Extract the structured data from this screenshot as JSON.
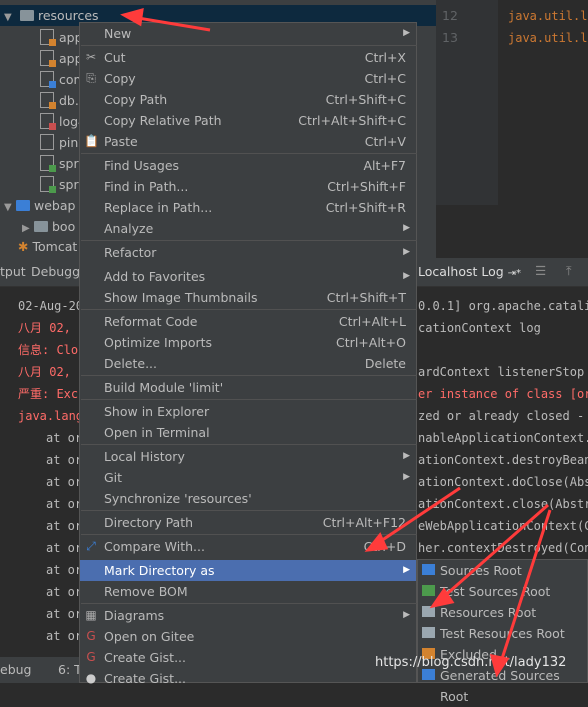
{
  "tree": {
    "resources": "resources",
    "files": [
      "app",
      "app",
      "com",
      "db.p",
      "log4",
      "piny",
      "spri",
      "spri"
    ],
    "webapp": "webap",
    "boot": "boo",
    "tomcat": "Tomcat"
  },
  "editor": {
    "lines": [
      "12",
      "13"
    ],
    "code": [
      "java.util.lo",
      "java.util.lo"
    ]
  },
  "toolbar": {
    "output": "tput",
    "debugger": "Debugger",
    "localhost_log": "Localhost Log"
  },
  "console": [
    {
      "t": "02-Aug-20",
      "r": "0.0.1] org.apache.catalin"
    },
    {
      "t": "八月 02,",
      "r": "cationContext log"
    },
    {
      "t": "信息: Clo",
      "r": ""
    },
    {
      "t": "八月 02,",
      "r": "ardContext listenerStop"
    },
    {
      "t": "严重: Exc",
      "r": "er instance of class [org"
    },
    {
      "t": "java.lang",
      "r": "zed or already closed - c"
    },
    {
      "t": "at or",
      "r": "nableApplicationContext.g"
    },
    {
      "t": "at or",
      "r": "ationContext.destroyBeans"
    },
    {
      "t": "at or",
      "r": "ationContext.doClose(Abstr"
    },
    {
      "t": "at or",
      "r": "ationContext.close(Abstra"
    },
    {
      "t": "at or",
      "r": "eWebApplicationContext(Co"
    },
    {
      "t": "at or",
      "r": "her.contextDestroyed(Cont"
    },
    {
      "t": "at or",
      "r": ""
    },
    {
      "t": "at or",
      "r": ""
    },
    {
      "t": "at or",
      "r": ""
    },
    {
      "t": "at or",
      "r": ""
    }
  ],
  "statusbar": {
    "debug": "ebug",
    "todo": "6: TO"
  },
  "menu": [
    {
      "label": "New",
      "shortcut": "",
      "sub": true
    },
    {
      "label": "Cut",
      "shortcut": "Ctrl+X"
    },
    {
      "label": "Copy",
      "shortcut": "Ctrl+C"
    },
    {
      "label": "Copy Path",
      "shortcut": "Ctrl+Shift+C"
    },
    {
      "label": "Copy Relative Path",
      "shortcut": "Ctrl+Alt+Shift+C"
    },
    {
      "label": "Paste",
      "shortcut": "Ctrl+V"
    },
    {
      "label": "Find Usages",
      "shortcut": "Alt+F7"
    },
    {
      "label": "Find in Path...",
      "shortcut": "Ctrl+Shift+F"
    },
    {
      "label": "Replace in Path...",
      "shortcut": "Ctrl+Shift+R"
    },
    {
      "label": "Analyze",
      "shortcut": "",
      "sub": true
    },
    {
      "label": "Refactor",
      "shortcut": "",
      "sub": true
    },
    {
      "label": "Add to Favorites",
      "shortcut": "",
      "sub": true
    },
    {
      "label": "Show Image Thumbnails",
      "shortcut": "Ctrl+Shift+T"
    },
    {
      "label": "Reformat Code",
      "shortcut": "Ctrl+Alt+L"
    },
    {
      "label": "Optimize Imports",
      "shortcut": "Ctrl+Alt+O"
    },
    {
      "label": "Delete...",
      "shortcut": "Delete"
    },
    {
      "label": "Build Module 'limit'",
      "shortcut": ""
    },
    {
      "label": "Show in Explorer",
      "shortcut": ""
    },
    {
      "label": "Open in Terminal",
      "shortcut": ""
    },
    {
      "label": "Local History",
      "shortcut": "",
      "sub": true
    },
    {
      "label": "Git",
      "shortcut": "",
      "sub": true
    },
    {
      "label": "Synchronize 'resources'",
      "shortcut": ""
    },
    {
      "label": "Directory Path",
      "shortcut": "Ctrl+Alt+F12"
    },
    {
      "label": "Compare With...",
      "shortcut": "Ctrl+D"
    },
    {
      "label": "Mark Directory as",
      "shortcut": "",
      "sub": true
    },
    {
      "label": "Remove BOM",
      "shortcut": ""
    },
    {
      "label": "Diagrams",
      "shortcut": "",
      "sub": true
    },
    {
      "label": "Open on Gitee",
      "shortcut": ""
    },
    {
      "label": "Create Gist...",
      "shortcut": ""
    },
    {
      "label": "Create Gist...",
      "shortcut": ""
    }
  ],
  "submenu": [
    {
      "label": "Sources Root",
      "color": "#3b7fd6"
    },
    {
      "label": "Test Sources Root",
      "color": "#4c9a4c"
    },
    {
      "label": "Resources Root",
      "color": "#9aa7b0"
    },
    {
      "label": "Test Resources Root",
      "color": "#9aa7b0"
    },
    {
      "label": "Excluded",
      "color": "#d3832f"
    },
    {
      "label": "Generated Sources Root",
      "color": "#3b7fd6"
    }
  ],
  "watermark": "https://blog.csdn.net/lady132"
}
